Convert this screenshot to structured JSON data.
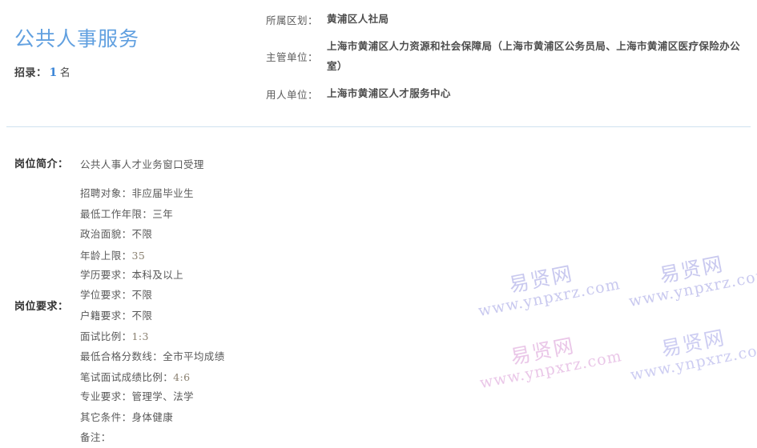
{
  "header": {
    "title": "公共人事服务",
    "recruit_label": "招录：",
    "recruit_count": "1",
    "recruit_unit": "名",
    "info_rows": [
      {
        "label": "所属区划：",
        "value": "黄浦区人社局"
      },
      {
        "label": "主管单位：",
        "value": "上海市黄浦区人力资源和社会保障局（上海市黄浦区公务员局、上海市黄浦区医疗保险办公室）"
      },
      {
        "label": "用人单位：",
        "value": "上海市黄浦区人才服务中心"
      }
    ]
  },
  "detail": {
    "intro_label": "岗位简介：",
    "intro_text": "公共人事人才业务窗口受理",
    "requirement_label": "岗位要求：",
    "lines": [
      {
        "text": "招聘对象：非应届毕业生"
      },
      {
        "text": "最低工作年限：三年"
      },
      {
        "text": "政治面貌：不限"
      },
      {
        "prefix": "年龄上限：",
        "number": "35"
      },
      {
        "text": "学历要求：本科及以上"
      },
      {
        "text": "学位要求：不限"
      },
      {
        "text": "户籍要求：不限"
      },
      {
        "prefix": "面试比例：",
        "number": "1:3"
      },
      {
        "text": "最低合格分数线：全市平均成绩"
      },
      {
        "prefix": "笔试面试成绩比例：",
        "number": "4:6"
      },
      {
        "text": "专业要求：管理学、法学"
      },
      {
        "text": "其它条件：身体健康"
      },
      {
        "text": "备注："
      }
    ]
  },
  "watermarks": {
    "cn": "易贤网",
    "url": "www.ynpxrz.com"
  },
  "colors": {
    "title_blue": "#61a0e0",
    "count_blue": "#3c86d8",
    "divider": "#cfe2ef",
    "text": "#595959",
    "watermark_blue": "#c9c9ef",
    "watermark_pink": "#eac7e8"
  }
}
